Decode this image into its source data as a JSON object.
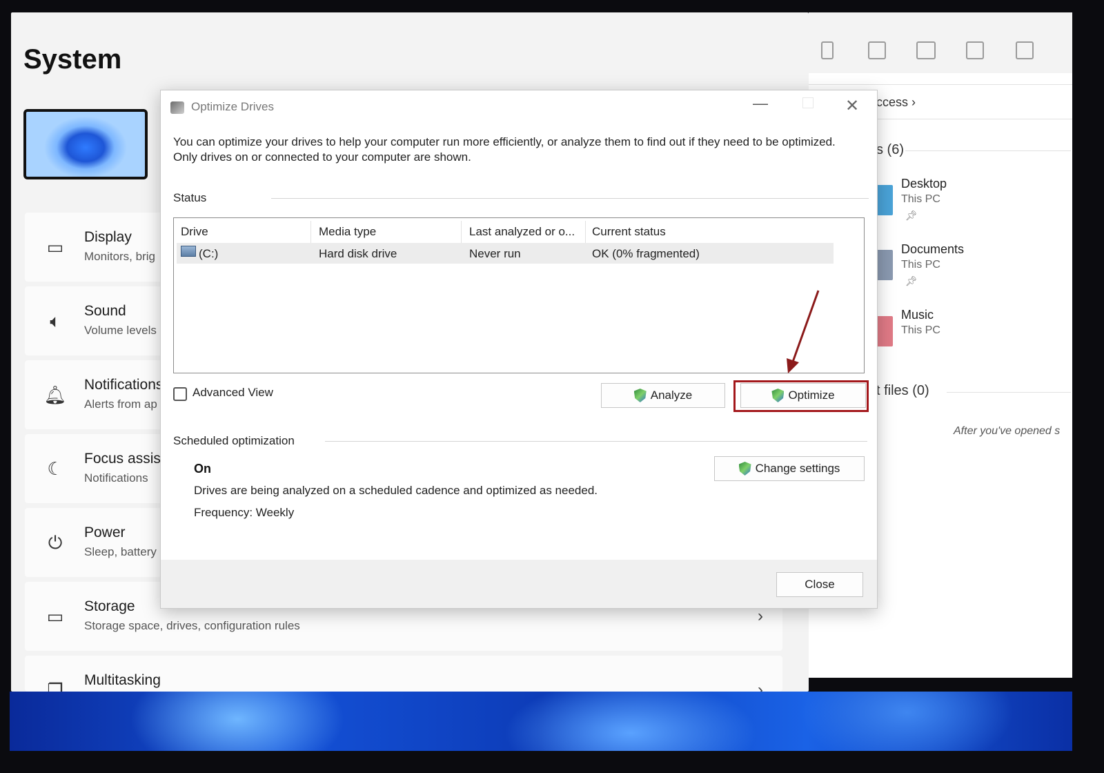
{
  "settings": {
    "title": "System",
    "items": [
      {
        "title": "Display",
        "subtitle": "Monitors, brig",
        "icon": "monitor-icon"
      },
      {
        "title": "Sound",
        "subtitle": "Volume levels",
        "icon": "speaker-icon"
      },
      {
        "title": "Notifications",
        "subtitle": "Alerts from ap",
        "icon": "bell-icon"
      },
      {
        "title": "Focus assist",
        "subtitle": "Notifications",
        "icon": "moon-icon"
      },
      {
        "title": "Power",
        "subtitle": "Sleep, battery",
        "icon": "power-icon"
      },
      {
        "title": "Storage",
        "subtitle": "Storage space, drives, configuration rules",
        "icon": "storage-icon"
      },
      {
        "title": "Multitasking",
        "subtitle": "",
        "icon": "multitasking-icon"
      }
    ],
    "chevron": "›"
  },
  "explorer": {
    "breadcrumb": "ccess ›",
    "folders_heading": "s (6)",
    "folders": [
      {
        "title": "Desktop",
        "location": "This PC",
        "color": "#4aa3d8"
      },
      {
        "title": "Documents",
        "location": "This PC",
        "color": "#8a99b0"
      },
      {
        "title": "Music",
        "location": "This PC",
        "color": "#e07a86"
      }
    ],
    "recent_heading": "t files (0)",
    "recent_note": "After you've opened s"
  },
  "dialog": {
    "title": "Optimize Drives",
    "description": "You can optimize your drives to help your computer run more efficiently, or analyze them to find out if they need to be optimized. Only drives on or connected to your computer are shown.",
    "status_label": "Status",
    "columns": [
      "Drive",
      "Media type",
      "Last analyzed or o...",
      "Current status"
    ],
    "rows": [
      {
        "drive": "(C:)",
        "media": "Hard disk drive",
        "last": "Never run",
        "status": "OK (0% fragmented)"
      }
    ],
    "advanced_view": "Advanced View",
    "analyze": "Analyze",
    "optimize": "Optimize",
    "scheduled_label": "Scheduled optimization",
    "schedule_state": "On",
    "schedule_text": "Drives are being analyzed on a scheduled cadence and optimized as needed.",
    "frequency": "Frequency: Weekly",
    "change_settings": "Change settings",
    "close": "Close",
    "highlight_color": "#a3171b"
  }
}
